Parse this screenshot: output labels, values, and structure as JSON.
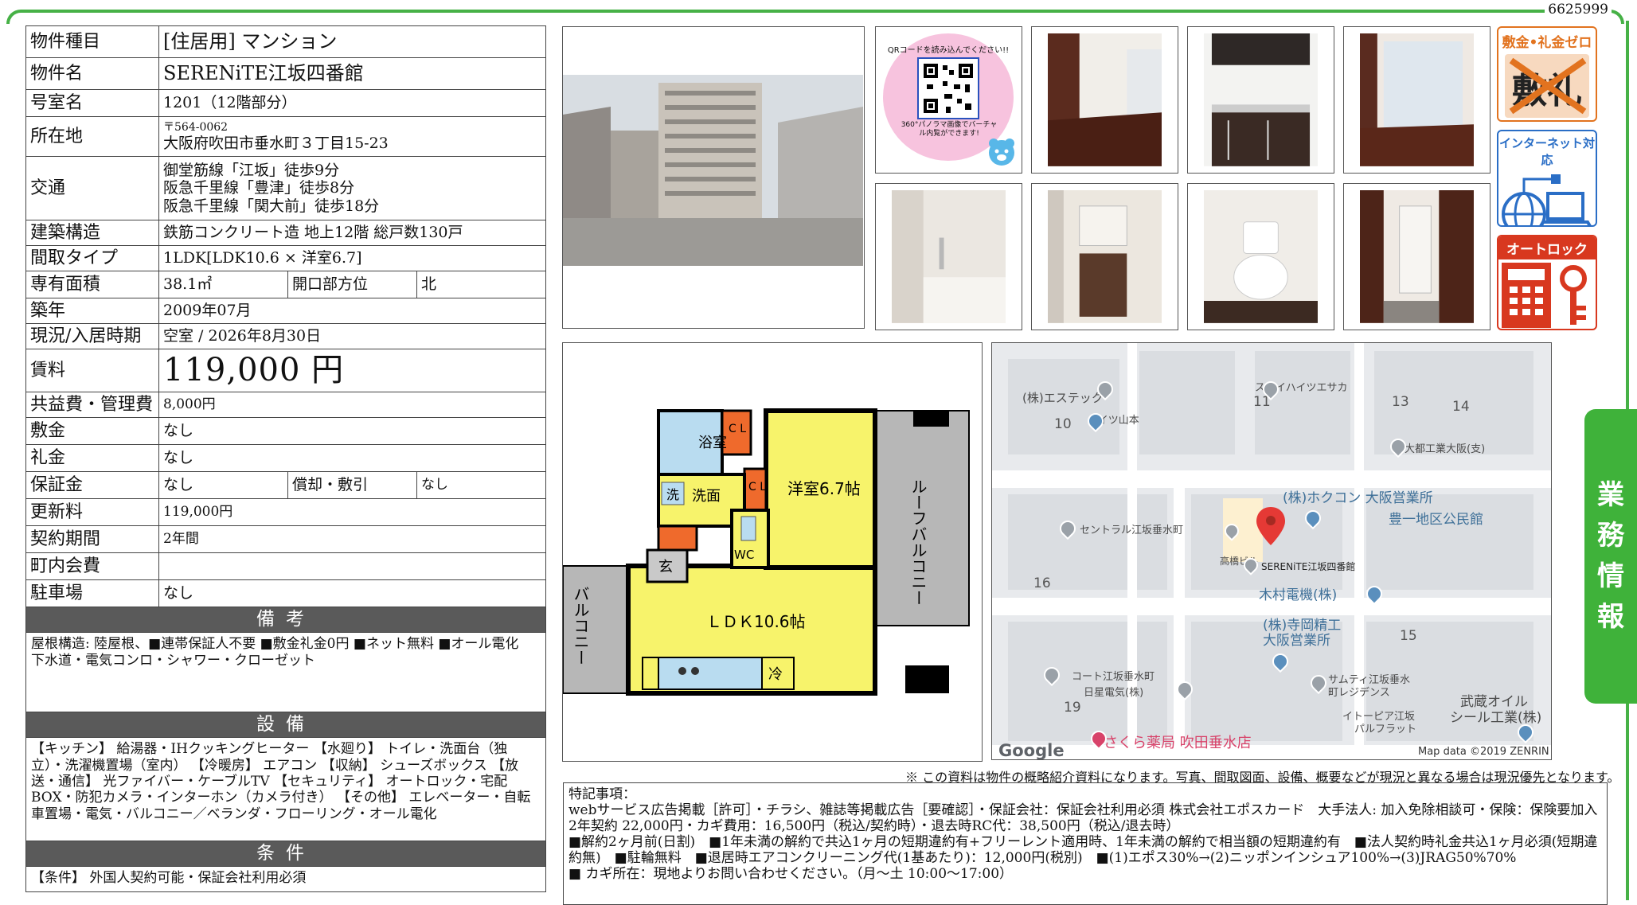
{
  "doc_id": "6625999",
  "spec": {
    "type_label": "物件種目",
    "type_value": "[住居用] マンション",
    "name_label": "物件名",
    "name_value": "SERENiTE江坂四番館",
    "room_label": "号室名",
    "room_value": "1201（12階部分）",
    "addr_label": "所在地",
    "addr_zip": "〒564-0062",
    "addr_value": "大阪府吹田市垂水町３丁目15-23",
    "traffic_label": "交通",
    "traffic_lines": [
      "御堂筋線「江坂」徒歩9分",
      "阪急千里線「豊津」徒歩8分",
      "阪急千里線「関大前」徒歩18分"
    ],
    "structure_label": "建築構造",
    "structure_value": "鉄筋コンクリート造 地上12階 総戸数130戸",
    "layout_label": "間取タイプ",
    "layout_value": "1LDK[LDK10.6 × 洋室6.7]",
    "area_label": "専有面積",
    "area_value": "38.1㎡",
    "facing_label": "開口部方位",
    "facing_value": "北",
    "built_label": "築年",
    "built_value": "2009年07月",
    "status_label": "現況/入居時期",
    "status_value": "空室 / 2026年8月30日",
    "rent_label": "賃料",
    "rent_value": "119,000 円",
    "fee_label": "共益費・管理費",
    "fee_value": "8,000円",
    "deposit_label": "敷金",
    "deposit_value": "なし",
    "key_label": "礼金",
    "key_value": "なし",
    "guarantee_label": "保証金",
    "guarantee_value": "なし",
    "amort_label": "償却・敷引",
    "amort_value": "なし",
    "renewal_label": "更新料",
    "renewal_value": "119,000円",
    "period_label": "契約期間",
    "period_value": "2年間",
    "assoc_label": "町内会費",
    "assoc_value": "",
    "parking_label": "駐車場",
    "parking_value": "なし"
  },
  "remarks_section": {
    "title": "備考",
    "text": "屋根構造: 陸屋根、■連帯保証人不要 ■敷金礼金0円 ■ネット無料 ■オール電化\n下水道・電気コンロ・シャワー・クローゼット"
  },
  "equipment_section": {
    "title": "設備",
    "text": "【キッチン】 給湯器・IHクッキングヒーター 【水廻り】 トイレ・洗面台（独立）・洗濯機置場（室内） 【冷暖房】 エアコン 【収納】 シューズボックス 【放送・通信】 光ファイバー・ケーブルTV 【セキュリティ】 オートロック・宅配BOX・防犯カメラ・インターホン（カメラ付き） 【その他】 エレベーター・自転車置場・電気・バルコニー／ベランダ・フローリング・オール電化"
  },
  "conditions_section": {
    "title": "条件",
    "text": "【条件】 外国人契約可能・保証会社利用必須"
  },
  "qr": {
    "top_text": "QRコードを読み込んでください!!",
    "bottom_text": "360°パノラマ画像でバーチャル内覧ができます!"
  },
  "badges": {
    "zero": "敷金•礼金ゼロ",
    "zero_glyph": "敷礼",
    "internet": "インターネット対応",
    "autolock": "オートロック"
  },
  "floorplan": {
    "bath": "浴室",
    "wash_icon": "洗",
    "wash": "洗面",
    "cl1": "C L",
    "cl2": "C L",
    "bedroom": "洋室6.7帖",
    "roof_balcony": "ルーフバルコニー",
    "entrance": "玄",
    "wc": "WC",
    "ldk": "ＬＤＫ10.6帖",
    "balcony": "バルコニー",
    "fridge": "冷"
  },
  "map": {
    "labels": [
      "(株)エステック",
      "ハイツ山本",
      "スカイハイツエサカ",
      "大都工業大阪(支)",
      "(株)ホクコン 大阪営業所",
      "豊一地区公民館",
      "セントラル江坂垂水町",
      "高橋ビル",
      "SERENiTE江坂四番館",
      "木村電機(株)",
      "(株)寺岡精工",
      "大阪営業所",
      "コート江坂垂水町",
      "日星電気(株)",
      "サムティ江坂垂水",
      "町レジデンス",
      "イトーピア江坂",
      "パルフラット",
      "武蔵オイル",
      "シール工業(株)",
      "さくら薬局 吹田垂水店"
    ],
    "block_numbers": [
      "10",
      "11",
      "13",
      "14",
      "16",
      "15",
      "19"
    ],
    "google": "Google",
    "credit": "Map data ©2019 ZENRIN"
  },
  "side_tab": [
    "業",
    "務",
    "情",
    "報"
  ],
  "disclaimer": "※ この資料は物件の概略紹介資料になります。写真、間取図面、設備、概要などが現況と異なる場合は現況優先となります。",
  "special_notes": {
    "title": "特記事項：",
    "lines": [
      "webサービス広告掲載［許可］・チラシ、雑誌等掲載広告［要確認］・保証会社：保証会社利用必須 株式会社エポスカード　大手法人: 加入免除相談可・保険：保険要加入 2年契約 22,000円・カギ費用：16,500円（税込/契約時）・退去時RC代：38,500円（税込/退去時）",
      "■解約2ヶ月前(日割)　■1年未満の解約で共込1ヶ月の短期違約有+フリーレント適用時、1年未満の解約で相当額の短期違約有　■法人契約時礼金共込1ヶ月必須(短期違約無)　■駐輪無料　■退居時エアコンクリーニング代(1基あたり)：12,000円(税別)　■(1)エポス30%→(2)ニッポンインシュア100%→(3)JRAG50%70%",
      "■ カギ所在：現地よりお問い合わせください。（月～土 10:00～17:00）"
    ]
  },
  "colors": {
    "frame": "#46b146",
    "section": "#5a5a5a",
    "plan_yellow": "#f7f36b",
    "plan_orange": "#ef6a2c",
    "plan_blue": "#b9dcf0",
    "badge_orange": "#e2731f"
  }
}
